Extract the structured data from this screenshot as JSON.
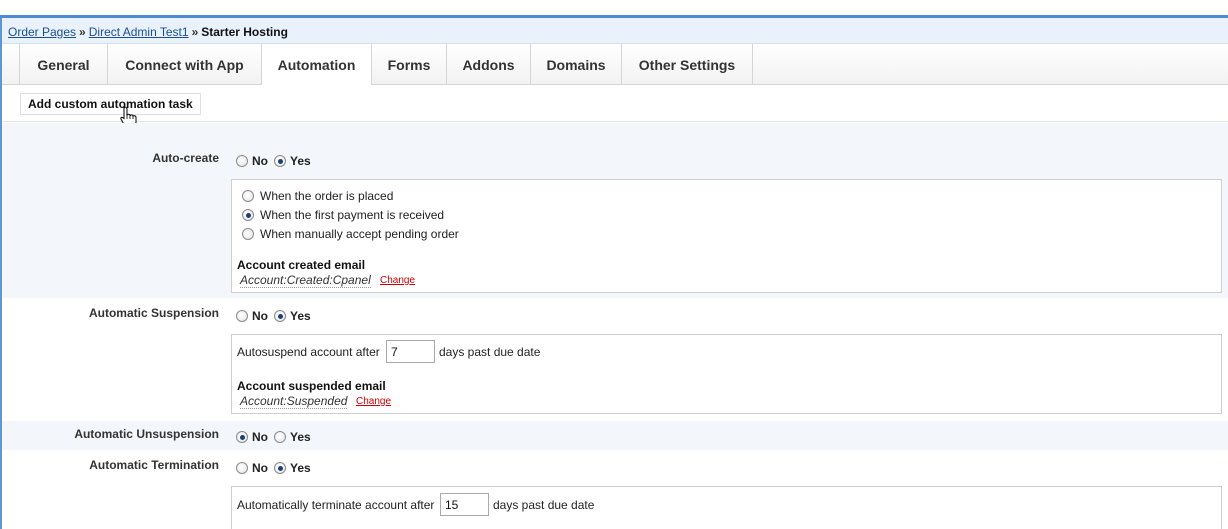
{
  "breadcrumb": {
    "link1": "Order Pages",
    "link2": "Direct Admin Test1",
    "separator": "»",
    "current": "Starter Hosting"
  },
  "tabs": [
    "General",
    "Connect with App",
    "Automation",
    "Forms",
    "Addons",
    "Domains",
    "Other Settings"
  ],
  "active_tab": "Automation",
  "toolbar": {
    "add_task_label": "Add custom automation task"
  },
  "options": {
    "no": "No",
    "yes": "Yes"
  },
  "autocreate": {
    "label": "Auto-create",
    "selected": "Yes",
    "triggers": [
      "When the order is placed",
      "When the first payment is received",
      "When manually accept pending order"
    ],
    "selected_trigger": 1,
    "email_title": "Account created email",
    "email_name": "Account:Created:Cpanel",
    "change_label": "Change"
  },
  "suspension": {
    "label": "Automatic Suspension",
    "selected": "Yes",
    "prefix": "Autosuspend account after",
    "days": "7",
    "suffix": "days past due date",
    "email_title": "Account suspended email",
    "email_name": "Account:Suspended",
    "change_label": "Change"
  },
  "unsuspension": {
    "label": "Automatic Unsuspension",
    "selected": "No"
  },
  "termination": {
    "label": "Automatic Termination",
    "selected": "Yes",
    "prefix": "Automatically terminate account after",
    "days": "15",
    "suffix": "days past due date"
  }
}
